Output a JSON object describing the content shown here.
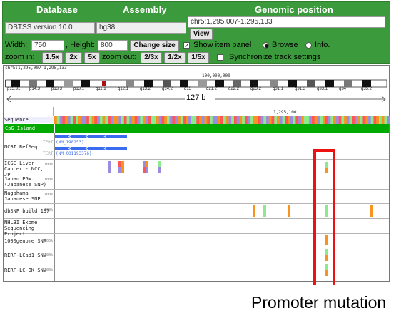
{
  "header": {
    "col_database": "Database",
    "col_assembly": "Assembly",
    "col_position": "Genomic position",
    "database_value": "DBTSS version 10.0",
    "assembly_value": "hg38",
    "position_value": "chr5:1,295,007-1,295,133",
    "view_label": "View"
  },
  "controls": {
    "width_label": "Width:",
    "width_value": "750",
    "height_label": ", Height:",
    "height_value": "800",
    "change_size_label": "Change size",
    "show_panel_label": "Show item panel",
    "show_panel_checked": true,
    "browse_label": "Browse",
    "info_label": "Info.",
    "mode_selected": "Browse",
    "zoom_in_label": "zoom in:",
    "zoom_in_buttons": [
      "1.5x",
      "2x",
      "5x"
    ],
    "zoom_out_label": "zoom out:",
    "zoom_out_buttons": [
      "2/3x",
      "1/2x",
      "1/5x"
    ],
    "sync_label": "Synchronize track settings",
    "sync_checked": false
  },
  "ideogram": {
    "position_text": "chr5:1,295,007-1,295,133",
    "scale_label": "100,000,000",
    "bands": [
      "p15.31",
      "p14.3",
      "p13.3",
      "p13.1",
      "q11.1",
      "q12.1",
      "q13.2",
      "q14.2",
      "q15",
      "q21.2",
      "q22.2",
      "q23.2",
      "q31.1",
      "q31.3",
      "q33.1",
      "q34",
      "q35.2"
    ],
    "span_label": "127 b",
    "coord_label": "1,295,100"
  },
  "tracks": {
    "sequence": "Sequence",
    "cpg": "CpG Island",
    "refseq": "NCBI RefSeq",
    "refseq_items": [
      {
        "gene": "TERT",
        "acc": "(NM_198253)"
      },
      {
        "gene": "TERT",
        "acc": "(NM_001193376)"
      }
    ],
    "icgc": "ICGC Liver Cancer - NCC, JP",
    "japan_pgx": "Japan PGx (Japanese SNP)",
    "nagahama": "Nagahama Japanese SNP",
    "dbsnp": "dbSNP build 137",
    "nhlbi": "NHLBI Exome Sequencing Project",
    "g1000": "1000genome SNP",
    "rerf1": "RERF-LCad1 SNV",
    "rerf2": "RERF-LC-OK SNV",
    "scale_labels": [
      "100%",
      "100%",
      "100%",
      "100%",
      "100%",
      "100%",
      "100%"
    ]
  },
  "colors": {
    "header_green": "#3b9a3b",
    "cpg_green": "#00aa00",
    "refseq_blue": "#3a6cf0",
    "mut_orange": "#f7931e",
    "mut_lightgreen": "#8ee88e",
    "mut_purple": "#9b8ce0",
    "mut_red": "#ff5555",
    "highlight_red": "#ee1111"
  },
  "annotation": {
    "caption": "Promoter mutation"
  }
}
